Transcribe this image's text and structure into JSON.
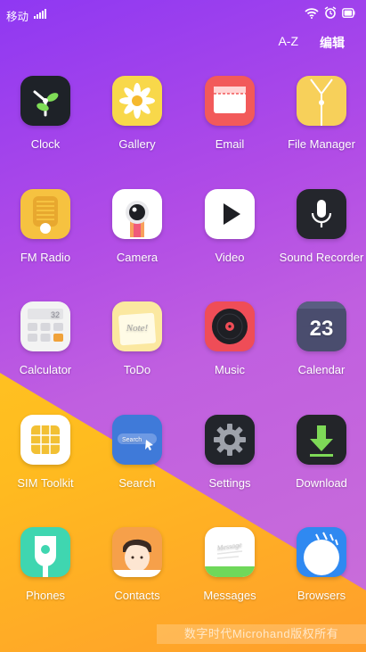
{
  "status_bar": {
    "carrier": "移动",
    "icons": [
      "wifi-icon",
      "alarm-icon",
      "battery-icon"
    ]
  },
  "top_bar": {
    "sort_label": "A-Z",
    "edit_label": "编辑"
  },
  "apps": [
    {
      "label": "Clock",
      "icon": "clock-icon",
      "color": "#1e2228"
    },
    {
      "label": "Gallery",
      "icon": "gallery-icon",
      "color": "#f8d84a"
    },
    {
      "label": "Email",
      "icon": "email-icon",
      "color": "#f25a5a"
    },
    {
      "label": "File Manager",
      "icon": "folder-icon",
      "color": "#f7d05a"
    },
    {
      "label": "FM Radio",
      "icon": "radio-icon",
      "color": "#f6c240"
    },
    {
      "label": "Camera",
      "icon": "camera-icon",
      "color": "#ffffff"
    },
    {
      "label": "Video",
      "icon": "play-icon",
      "color": "#ffffff"
    },
    {
      "label": "Sound Recorder",
      "icon": "microphone-icon",
      "color": "#24262c"
    },
    {
      "label": "Calculator",
      "icon": "calculator-icon",
      "color": "#f3f3f3"
    },
    {
      "label": "ToDo",
      "icon": "note-icon",
      "color": "#fbe8a0"
    },
    {
      "label": "Music",
      "icon": "music-disc-icon",
      "color": "#ef4d57"
    },
    {
      "label": "Calendar",
      "icon": "calendar-icon",
      "color": "#4a4d6e"
    },
    {
      "label": "SIM Toolkit",
      "icon": "sim-card-icon",
      "color": "#ffffff"
    },
    {
      "label": "Search",
      "icon": "search-icon",
      "color": "#3f7ad9"
    },
    {
      "label": "Settings",
      "icon": "gear-icon",
      "color": "#22252b"
    },
    {
      "label": "Download",
      "icon": "download-icon",
      "color": "#232529"
    },
    {
      "label": "Phones",
      "icon": "phone-icon",
      "color": "#3fd6b0"
    },
    {
      "label": "Contacts",
      "icon": "contact-icon",
      "color": "#f6a04a"
    },
    {
      "label": "Messages",
      "icon": "messages-icon",
      "color": "#ffffff"
    },
    {
      "label": "Browsers",
      "icon": "browser-icon",
      "color": "#2f89f1"
    }
  ],
  "icon_text": {
    "search_box": "Search",
    "calendar_day": "23",
    "calc_display": "32",
    "todo_note": "Note!",
    "message_note": "Message"
  },
  "watermark": "数字时代Microhand版权所有"
}
